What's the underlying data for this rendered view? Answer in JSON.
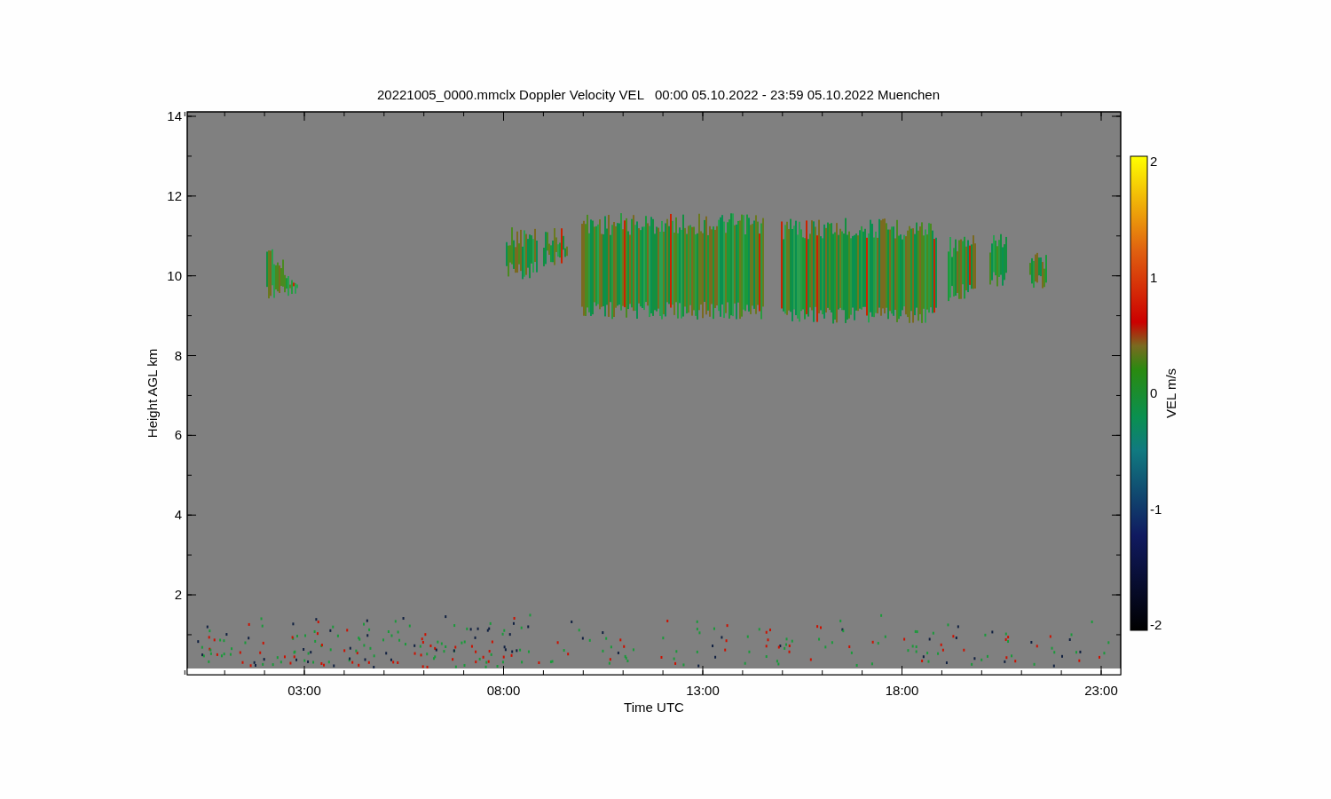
{
  "title": "20221005_0000.mmclx Doppler Velocity VEL   00:00 05.10.2022 - 23:59 05.10.2022 Muenchen",
  "y_axis": {
    "label": "Height AGL km",
    "ticks": [
      "14",
      "12",
      "10",
      "8",
      "6",
      "4",
      "2"
    ]
  },
  "x_axis": {
    "label": "Time UTC",
    "ticks": [
      "03:00",
      "08:00",
      "13:00",
      "18:00",
      "23:00"
    ]
  },
  "colorbar": {
    "label": "VEL m/s",
    "ticks": [
      "2",
      "1",
      "0",
      "-1",
      "-2"
    ]
  }
}
